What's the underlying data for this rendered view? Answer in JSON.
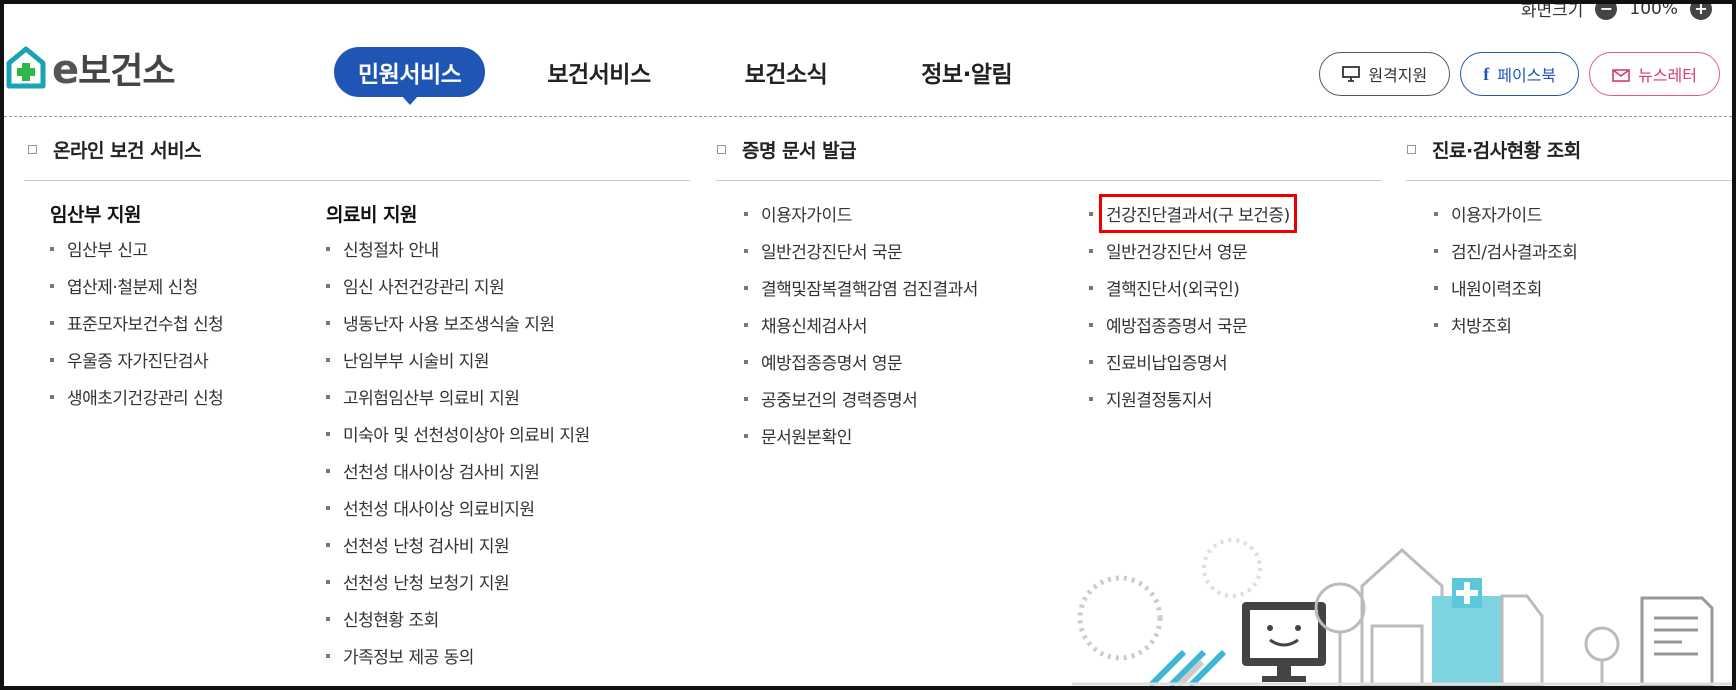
{
  "zoom": {
    "label": "화면크기",
    "minus": "−",
    "value": "100%",
    "plus": "+"
  },
  "brand": {
    "e": "e",
    "name": "보건소"
  },
  "nav": [
    {
      "label": "민원서비스",
      "active": true
    },
    {
      "label": "보건서비스"
    },
    {
      "label": "보건소식"
    },
    {
      "label": "정보·알림"
    }
  ],
  "util": {
    "remote": "원격지원",
    "facebook": "페이스북",
    "newsletter": "뉴스레터"
  },
  "sections": {
    "online": {
      "title": "온라인 보건 서비스",
      "col1": {
        "head": "임산부 지원",
        "items": [
          "임산부 신고",
          "엽산제·철분제 신청",
          "표준모자보건수첩 신청",
          "우울증 자가진단검사",
          "생애초기건강관리 신청"
        ]
      },
      "col2": {
        "head": "의료비 지원",
        "items": [
          "신청절차 안내",
          "임신 사전건강관리 지원",
          "냉동난자 사용 보조생식술 지원",
          "난임부부 시술비 지원",
          "고위험임산부 의료비 지원",
          "미숙아 및 선천성이상아 의료비 지원",
          "선천성 대사이상 검사비 지원",
          "선천성 대사이상 의료비지원",
          "선천성 난청 검사비 지원",
          "선천성 난청 보청기 지원",
          "신청현황 조회",
          "가족정보 제공 동의"
        ]
      }
    },
    "certs": {
      "title": "증명 문서 발급",
      "col1": [
        "이용자가이드",
        "일반건강진단서 국문",
        "결핵및잠복결핵감염 검진결과서",
        "채용신체검사서",
        "예방접종증명서 영문",
        "공중보건의 경력증명서",
        "문서원본확인"
      ],
      "col2": [
        "건강진단결과서(구 보건증)",
        "일반건강진단서 영문",
        "결핵진단서(외국인)",
        "예방접종증명서 국문",
        "진료비납입증명서",
        "지원결정통지서"
      ]
    },
    "status": {
      "title": "진료·검사현황 조회",
      "items": [
        "이용자가이드",
        "검진/검사결과조회",
        "내원이력조회",
        "처방조회"
      ]
    }
  },
  "colors": {
    "primary": "#1f55b4",
    "highlight": "#e00000",
    "newsletter": "#d63a74"
  }
}
